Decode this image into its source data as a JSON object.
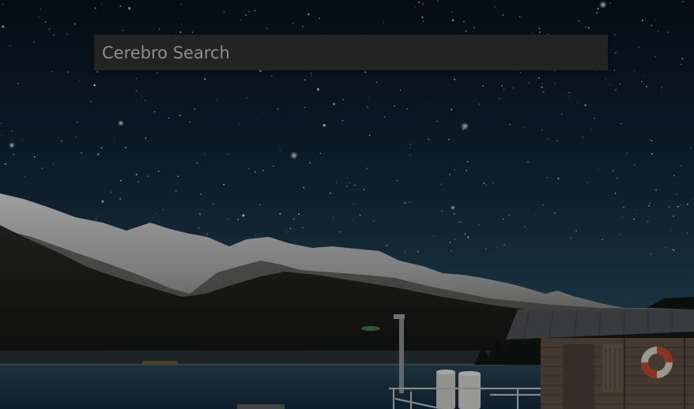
{
  "search": {
    "placeholder": "Cerebro Search",
    "value": ""
  },
  "wallpaper": {
    "icon": "night-lake-landscape-image"
  },
  "colors": {
    "search_background": "#242424",
    "search_text": "#8e8e8e",
    "sky_top": "#08121e",
    "sky_bottom": "#1f4050",
    "lake": "#1b3340"
  }
}
